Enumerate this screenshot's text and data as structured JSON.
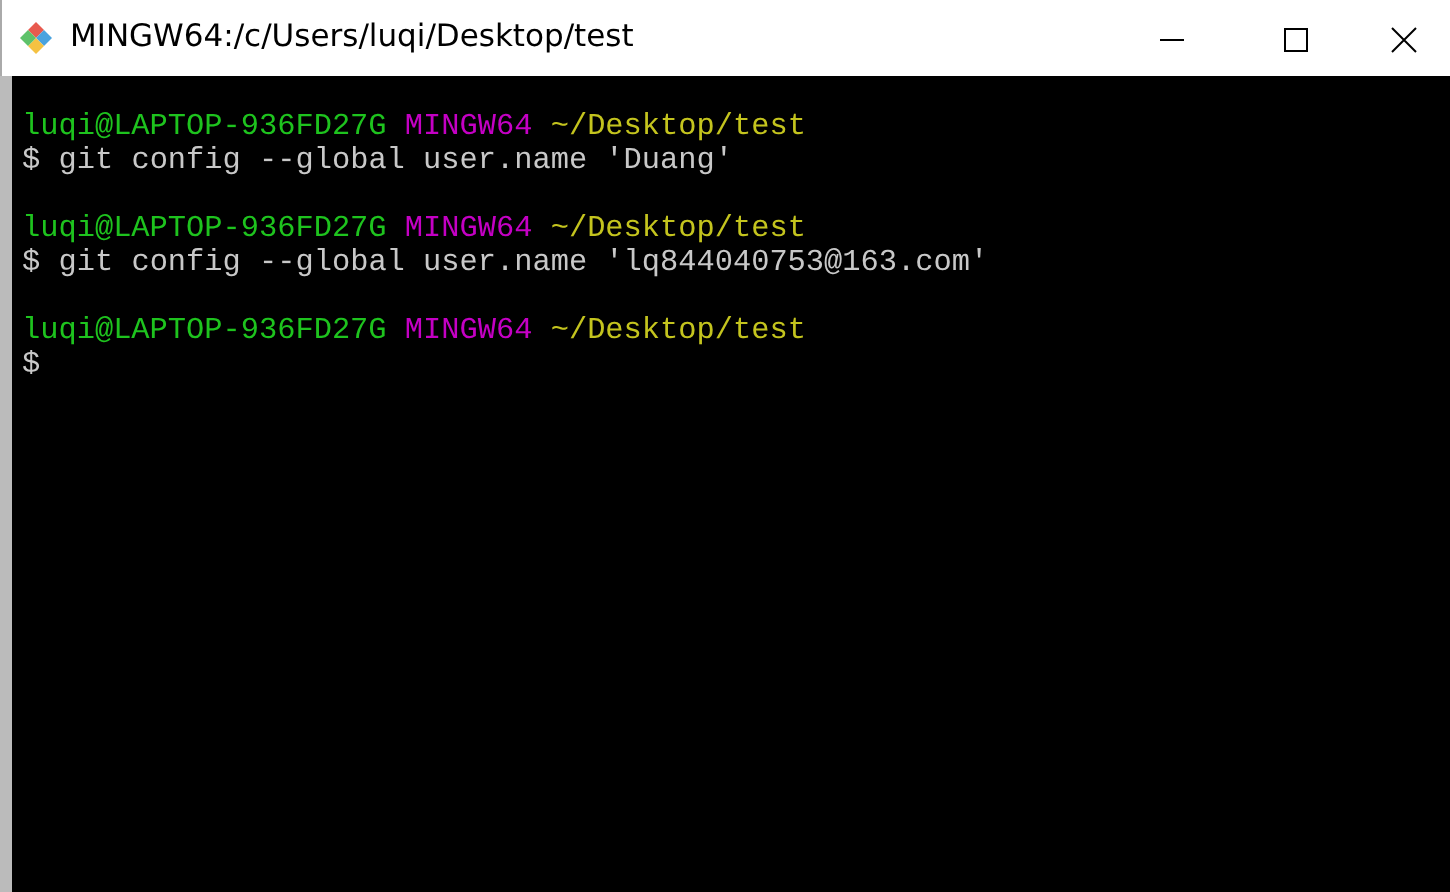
{
  "window": {
    "title": "MINGW64:/c/Users/luqi/Desktop/test"
  },
  "terminal": {
    "lines": [
      {
        "kind": "prompt",
        "user_host": "luqi@LAPTOP-936FD27G",
        "system": "MINGW64",
        "path": "~/Desktop/test"
      },
      {
        "kind": "command",
        "symbol": "$",
        "text": "git config --global user.name 'Duang'"
      },
      {
        "kind": "blank"
      },
      {
        "kind": "prompt",
        "user_host": "luqi@LAPTOP-936FD27G",
        "system": "MINGW64",
        "path": "~/Desktop/test"
      },
      {
        "kind": "command",
        "symbol": "$",
        "text": "git config --global user.name 'lq844040753@163.com'"
      },
      {
        "kind": "blank"
      },
      {
        "kind": "prompt",
        "user_host": "luqi@LAPTOP-936FD27G",
        "system": "MINGW64",
        "path": "~/Desktop/test"
      },
      {
        "kind": "command",
        "symbol": "$"
      }
    ]
  }
}
